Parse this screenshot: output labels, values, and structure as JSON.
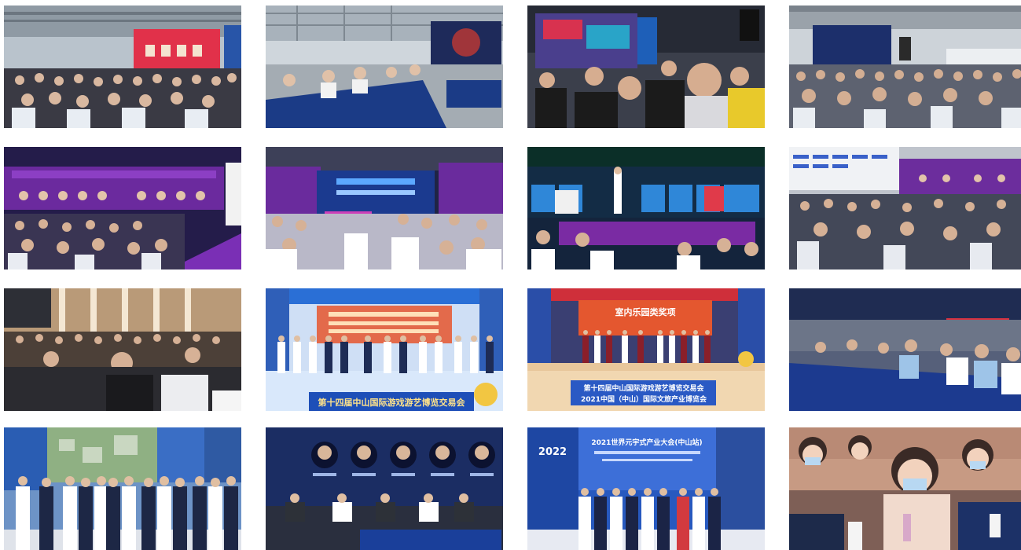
{
  "gallery": {
    "photos": [
      {
        "scene": "expo-hall-audience-red-stage"
      },
      {
        "scene": "panel-table-blue-cloths"
      },
      {
        "scene": "crowd-led-wall"
      },
      {
        "scene": "crowded-seminar-hall"
      },
      {
        "scene": "purple-stage-forum"
      },
      {
        "scene": "purple-stage-audience-white-chairs"
      },
      {
        "scene": "dark-stage-speaker-ranking"
      },
      {
        "scene": "forum-purple-screen-audience"
      },
      {
        "scene": "hotel-ballroom-conference"
      },
      {
        "scene": "opening-ceremony-group",
        "caption": "第十四届中山国际游戏游艺博览交易会"
      },
      {
        "scene": "award-ceremony-orange-stage",
        "caption": "第十四届中山国际游戏游艺博览交易会",
        "caption2": "2021中国（中山）国际文旅产业博览会",
        "stage_title": "室内乐园类奖项"
      },
      {
        "scene": "roundtable-blue-cloths"
      },
      {
        "scene": "guests-group-photo"
      },
      {
        "scene": "dialogue-panel-portraits"
      },
      {
        "scene": "meta-conference-group",
        "title": "2021世界元宇式产业大会(中山站)",
        "year": "2022"
      },
      {
        "scene": "audience-closeup-masks"
      }
    ]
  }
}
